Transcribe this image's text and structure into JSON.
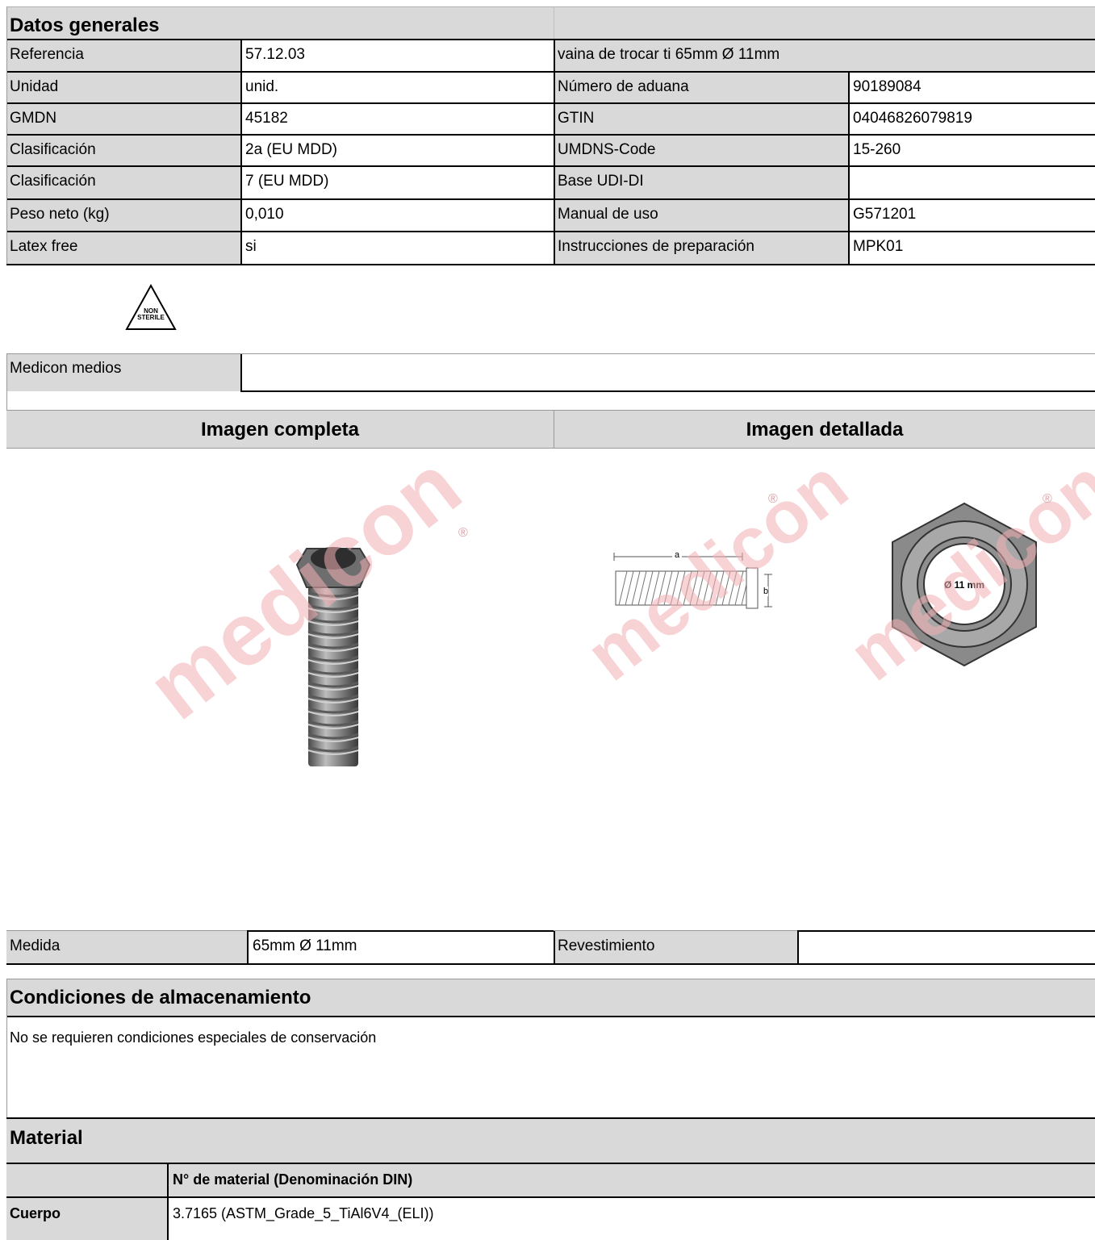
{
  "general": {
    "title": "Datos generales",
    "rows": [
      {
        "label": "Referencia",
        "value": "57.12.03",
        "label2": "vaina de trocar ti 65mm Ø 11mm",
        "value2": ""
      },
      {
        "label": "Unidad",
        "value": "unid.",
        "label2": "Número de aduana",
        "value2": "90189084"
      },
      {
        "label": "GMDN",
        "value": "45182",
        "label2": "GTIN",
        "value2": "04046826079819"
      },
      {
        "label": "Clasificación",
        "value": "2a (EU MDD)",
        "label2": "UMDNS-Code",
        "value2": "15-260"
      },
      {
        "label": "Clasificación",
        "value": "7 (EU MDD)",
        "label2": "Base UDI-DI",
        "value2": ""
      },
      {
        "label": "Peso neto (kg)",
        "value": "0,010",
        "label2": "Manual de uso",
        "value2": "G571201"
      },
      {
        "label": "Latex free",
        "value": "si",
        "label2": "Instrucciones de preparación",
        "value2": "MPK01"
      }
    ],
    "symbol_line1": "NON",
    "symbol_line2": "STERILE",
    "media_label": "Medicon medios",
    "media_value": ""
  },
  "images": {
    "full_title": "Imagen completa",
    "detail_title": "Imagen detallada",
    "watermark": "medicon",
    "registered": "®",
    "dim_a": "a",
    "dim_b": "b",
    "diameter_label": "Ø 11 mm"
  },
  "measure": {
    "label": "Medida",
    "value": "65mm Ø 11mm",
    "label2": "Revestimiento",
    "value2": ""
  },
  "storage": {
    "title": "Condiciones de almacenamiento",
    "text": "No se requieren condiciones especiales de conservación"
  },
  "material": {
    "title": "Material",
    "column_header": "N° de material (Denominación DIN)",
    "rows": [
      {
        "part": "Cuerpo",
        "value": "3.7165 (ASTM_Grade_5_TiAl6V4_(ELI))"
      }
    ]
  },
  "colors": {
    "header_bg": "#d9d9d9",
    "watermark": "#f3b0b5"
  }
}
